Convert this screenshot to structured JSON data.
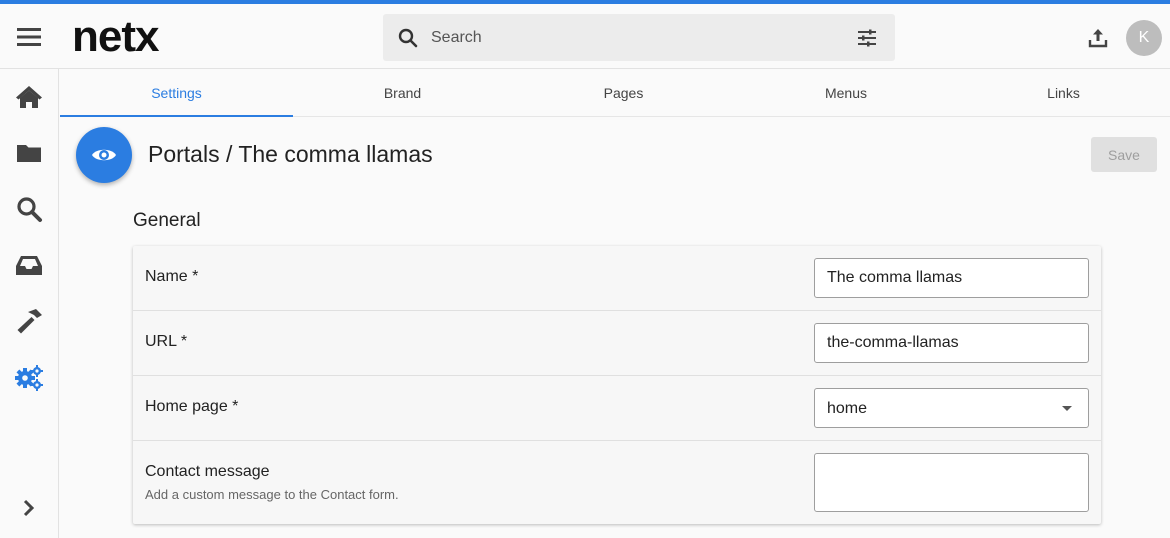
{
  "app": {
    "logo_text": "netx",
    "accent_color": "#2b7de1",
    "avatar_initial": "K"
  },
  "search": {
    "placeholder": "Search",
    "icon": "search-icon",
    "filter_icon": "filter-sliders-icon"
  },
  "sidebar": {
    "items": [
      {
        "name": "home",
        "icon": "home-icon"
      },
      {
        "name": "folders",
        "icon": "folder-icon"
      },
      {
        "name": "search",
        "icon": "search-icon"
      },
      {
        "name": "inbox",
        "icon": "inbox-icon"
      },
      {
        "name": "tools",
        "icon": "hammer-icon"
      },
      {
        "name": "settings",
        "icon": "gears-icon",
        "active": true
      }
    ],
    "expand_icon": "chevron-right-icon"
  },
  "tabs": [
    {
      "label": "Settings",
      "active": true
    },
    {
      "label": "Brand"
    },
    {
      "label": "Pages"
    },
    {
      "label": "Menus"
    },
    {
      "label": "Links"
    }
  ],
  "page": {
    "title": "Portals / The comma llamas",
    "icon": "eye-icon",
    "save_label": "Save"
  },
  "general": {
    "section_title": "General",
    "fields": {
      "name": {
        "label": "Name *",
        "value": "The comma llamas"
      },
      "url": {
        "label": "URL *",
        "value": "the-comma-llamas"
      },
      "home_page": {
        "label": "Home page *",
        "value": "home"
      },
      "contact_message": {
        "label": "Contact message",
        "description": "Add a custom message to the Contact form.",
        "value": ""
      }
    }
  }
}
